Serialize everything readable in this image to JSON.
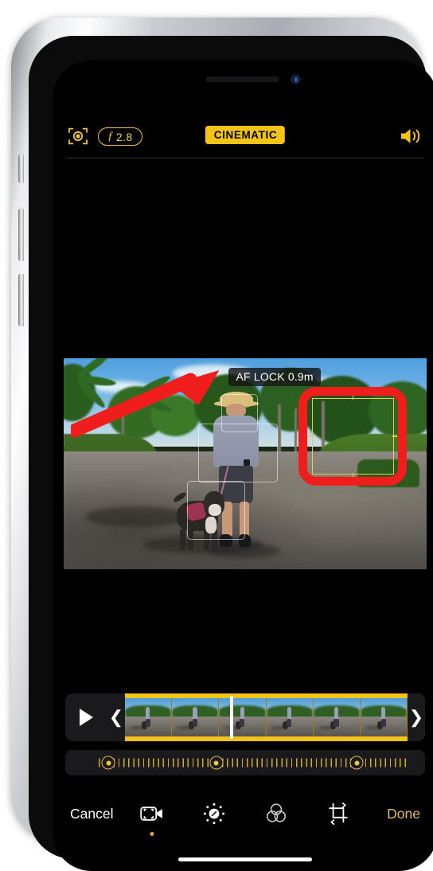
{
  "device": {
    "name": "iphone-frame",
    "earpiece": "earpiece-speaker",
    "front_camera": "front-camera-icon",
    "buttons": [
      "silent-switch",
      "volume-up",
      "volume-down",
      "power"
    ]
  },
  "app": {
    "screen": "photos-cinematic-video-editor",
    "topbar": {
      "depth_icon": "depth-control-icon",
      "aperture_f_glyph": "ƒ",
      "aperture_value": "2.8",
      "mode_badge": "CINEMATIC",
      "speaker_icon": "speaker-on-icon"
    },
    "preview": {
      "af_lock_label": "AF LOCK 0.9m",
      "tracking_boxes": [
        "face",
        "body",
        "dog"
      ],
      "focus_box": "manual-focus-box-yellow"
    },
    "annotations": [
      {
        "type": "arrow",
        "color": "#f01d1d",
        "points_to": "af-lock-badge"
      },
      {
        "type": "rounded-rect",
        "color": "#f01d1d",
        "highlights": "manual-focus-box"
      }
    ],
    "filmstrip": {
      "play_icon": "play-icon",
      "trim_handle_left": "❮",
      "trim_handle_right": "❯",
      "frame_count": 6,
      "playhead_position_pct": 38.5
    },
    "focus_track": {
      "keyframes": [
        {
          "label": "focus-keyframe-1",
          "position_pct": 10
        },
        {
          "label": "focus-keyframe-2",
          "position_pct": 41
        },
        {
          "label": "focus-keyframe-3",
          "position_pct": 82
        }
      ]
    },
    "toolbar": {
      "cancel_label": "Cancel",
      "done_label": "Done",
      "tools": [
        {
          "name": "cinematic-video-tool",
          "icon": "video-cinematic-icon",
          "active": true
        },
        {
          "name": "adjust-tool",
          "icon": "adjust-dial-icon",
          "active": false
        },
        {
          "name": "filters-tool",
          "icon": "filters-circles-icon",
          "active": false
        },
        {
          "name": "crop-tool",
          "icon": "crop-rotate-icon",
          "active": false
        }
      ]
    },
    "home_indicator": "home-indicator"
  },
  "colors": {
    "accent_yellow": "#f3c316",
    "done_gold": "#e3bc57",
    "annotation_red": "#f01d1d",
    "panel_dark": "#1a1a1c"
  }
}
